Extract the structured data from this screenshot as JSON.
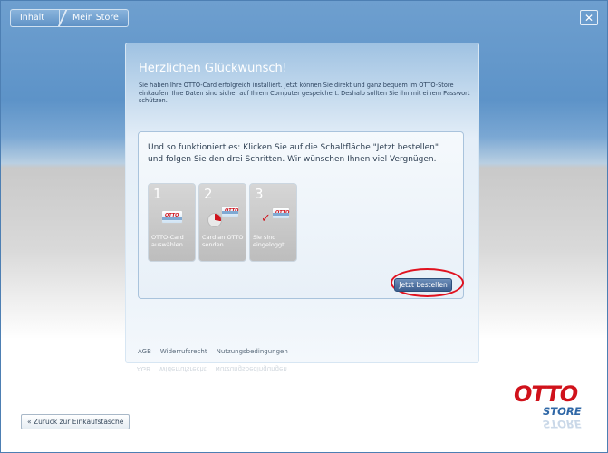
{
  "breadcrumb": {
    "items": [
      "Inhalt",
      "Mein Store"
    ]
  },
  "close_button": {
    "icon": "close-icon",
    "glyph": "✕"
  },
  "panel": {
    "title": "Herzlichen Glückwunsch!",
    "intro": "Sie haben Ihre OTTO-Card erfolgreich installiert. Jetzt können Sie direkt und ganz bequem im OTTO-Store einkaufen. Ihre Daten sind sicher auf Ihrem Computer gespeichert. Deshalb sollten Sie ihn mit einem Passwort schützen.",
    "steps_intro": "Und so funktioniert es: Klicken Sie auf die Schaltfläche \"Jetzt bestellen\" und folgen Sie den drei Schritten. Wir wünschen Ihnen viel Vergnügen.",
    "steps": [
      {
        "number": "1",
        "label": "OTTO-Card auswählen",
        "icon": "card-icon"
      },
      {
        "number": "2",
        "label": "Card an OTTO senden",
        "icon": "send-card-icon"
      },
      {
        "number": "3",
        "label": "Sie sind eingeloggt",
        "icon": "check-card-icon"
      }
    ],
    "order_button": "Jetzt bestellen",
    "card_logo_text": "OTTO"
  },
  "footer": {
    "links": [
      "AGB",
      "Widerrufsrecht",
      "Nutzungsbedingungen"
    ]
  },
  "back_button": "« Zurück zur Einkaufstasche",
  "brand": {
    "otto": "OTTO",
    "store": "STORE"
  },
  "colors": {
    "accent_red": "#d0121b",
    "brand_blue": "#2f67a6",
    "button_blue": "#3c5f8f"
  }
}
